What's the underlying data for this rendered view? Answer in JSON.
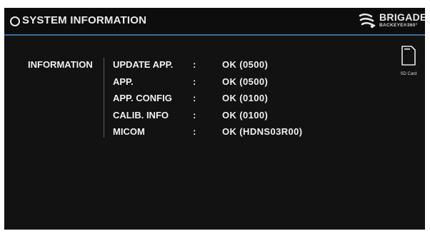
{
  "header": {
    "title": "SYSTEM INFORMATION",
    "icon": "circle-icon",
    "brand_name": "BRIGADE",
    "brand_sub": "BACKEYE®360°",
    "accent_color": "#3a6d97"
  },
  "section": {
    "label": "INFORMATION"
  },
  "info": [
    {
      "key": "UPDATE APP.",
      "sep": ":",
      "value": "OK (0500)"
    },
    {
      "key": "APP.",
      "sep": ":",
      "value": "OK (0500)"
    },
    {
      "key": "APP. CONFIG",
      "sep": ":",
      "value": "OK (0100)"
    },
    {
      "key": "CALIB. INFO",
      "sep": ":",
      "value": "OK (0100)"
    },
    {
      "key": "MICOM",
      "sep": ":",
      "value": "OK (HDNS03R00)"
    }
  ],
  "sd_card": {
    "label": "SD Card",
    "icon": "sd-card-icon"
  }
}
